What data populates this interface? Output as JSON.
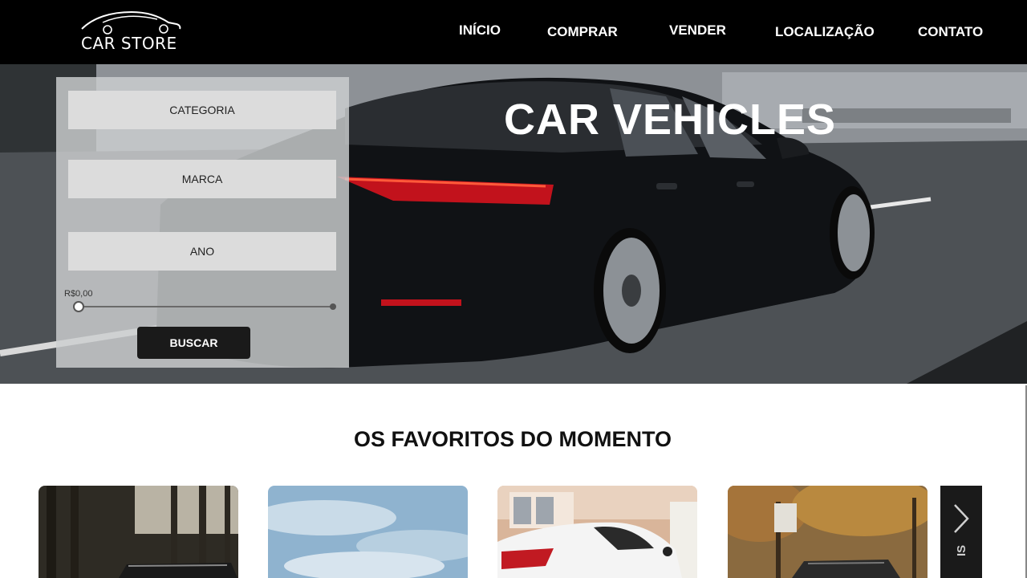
{
  "brand": {
    "name": "CAR STORE"
  },
  "nav": {
    "items": [
      {
        "label": "INÍCIO"
      },
      {
        "label": "COMPRAR"
      },
      {
        "label": "VENDER"
      },
      {
        "label": "LOCALIZAÇÃO"
      },
      {
        "label": "CONTATO"
      }
    ]
  },
  "hero": {
    "title": "CAR VEHICLES"
  },
  "search": {
    "category_label": "CATEGORIA",
    "brand_label": "MARCA",
    "year_label": "ANO",
    "price_value": "R$0,00",
    "price_slider_fraction": 0,
    "button_label": "BUSCAR"
  },
  "favorites": {
    "title": "OS FAVORITOS DO MOMENTO",
    "next_partial_text": "IS"
  },
  "colors": {
    "nav_bg": "#000000",
    "button_bg": "#1a1a1a",
    "field_bg": "#dcdcdc"
  }
}
